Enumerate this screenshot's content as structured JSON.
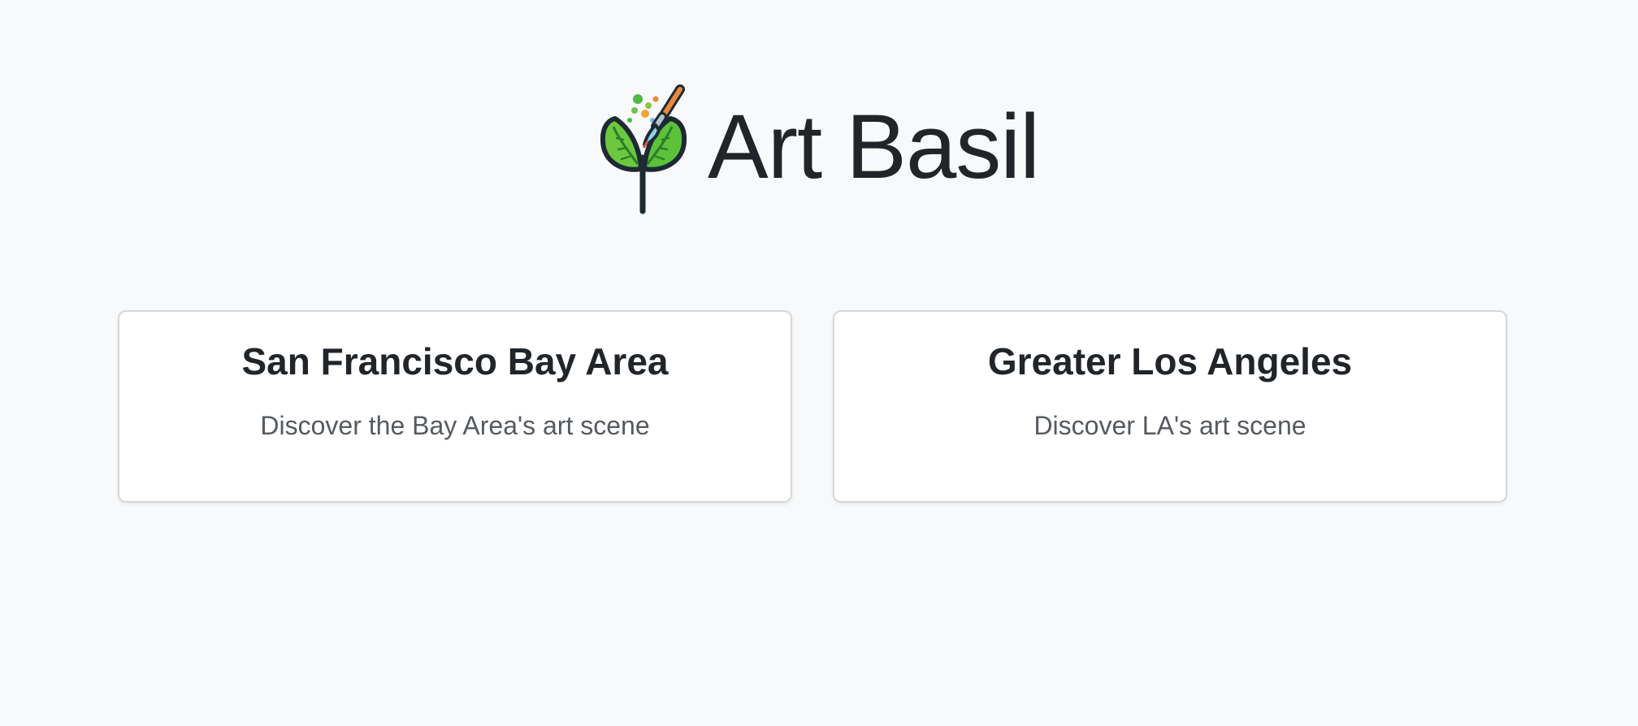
{
  "brand": {
    "name": "Art Basil",
    "logo_icon": "basil-leaf-paintbrush-icon"
  },
  "regions": [
    {
      "title": "San Francisco Bay Area",
      "description": "Discover the Bay Area's art scene"
    },
    {
      "title": "Greater Los Angeles",
      "description": "Discover LA's art scene"
    }
  ],
  "colors": {
    "background": "#f8f9fa",
    "text": "#212529",
    "muted_text": "#555a60",
    "leaf_green": "#5cc23a",
    "brush_orange": "#e8893b"
  }
}
